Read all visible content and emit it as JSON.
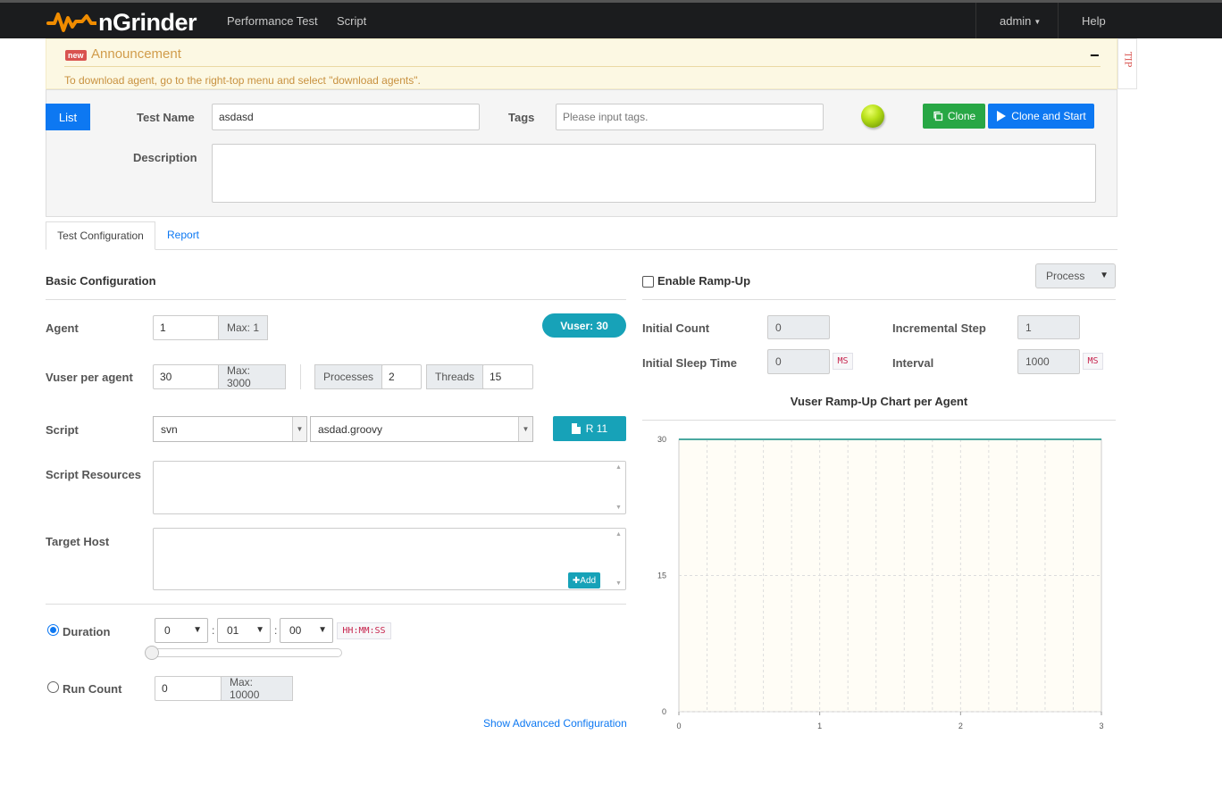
{
  "navbar": {
    "brand": "nGrinder",
    "links": [
      "Performance Test",
      "Script"
    ],
    "user": "admin",
    "help": "Help"
  },
  "announcement": {
    "badge": "new",
    "title": "Announcement",
    "text": "To download agent, go to the right-top menu and select \"download agents\".",
    "collapse": "−",
    "tip": "TIP"
  },
  "header": {
    "list_button": "List",
    "test_name_label": "Test Name",
    "test_name_value": "asdasd",
    "tags_label": "Tags",
    "tags_placeholder": "Please input tags.",
    "description_label": "Description",
    "description_value": "",
    "clone_button": "Clone",
    "clone_start_button": "Clone and Start"
  },
  "tabs": {
    "config": "Test Configuration",
    "report": "Report"
  },
  "basic": {
    "title": "Basic Configuration",
    "agent_label": "Agent",
    "agent_value": "1",
    "agent_max": "Max: 1",
    "vuser_badge": "Vuser: 30",
    "vuser_label": "Vuser per agent",
    "vuser_value": "30",
    "vuser_max": "Max: 3000",
    "processes_label": "Processes",
    "processes_value": "2",
    "threads_label": "Threads",
    "threads_value": "15",
    "script_label": "Script",
    "script_repo": "svn",
    "script_file": "asdad.groovy",
    "revision_button": "R 11",
    "resources_label": "Script Resources",
    "target_host_label": "Target Host",
    "add_button": "✚Add",
    "duration_label": "Duration",
    "duration_hours": "0",
    "duration_minutes": "01",
    "duration_seconds": "00",
    "duration_format": "HH:MM:SS",
    "run_count_label": "Run Count",
    "run_count_value": "0",
    "run_count_max": "Max: 10000",
    "advanced_link": "Show Advanced Configuration"
  },
  "rampup": {
    "enable_label": "Enable Ramp-Up",
    "mode": "Process",
    "initial_count_label": "Initial Count",
    "initial_count_value": "0",
    "incremental_step_label": "Incremental Step",
    "incremental_step_value": "1",
    "initial_sleep_label": "Initial Sleep Time",
    "initial_sleep_value": "0",
    "interval_label": "Interval",
    "interval_value": "1000",
    "ms_unit": "MS",
    "chart_title": "Vuser Ramp-Up Chart per Agent"
  },
  "colors": {
    "primary": "#0d78f2",
    "success": "#28a745",
    "info": "#17a2b8",
    "navbar": "#1b1c1e",
    "chart_line": "#4aa8a0",
    "chart_bg": "#fffdf6"
  },
  "chart_data": {
    "type": "line",
    "x": [
      0,
      3
    ],
    "series": [
      {
        "values": [
          30,
          30
        ]
      }
    ],
    "xticks": [
      "0",
      "1",
      "2",
      "3"
    ],
    "yticks": [
      "0",
      "15",
      "30"
    ],
    "xlim": [
      0,
      3
    ],
    "ylim": [
      0,
      30
    ],
    "grid": true
  }
}
